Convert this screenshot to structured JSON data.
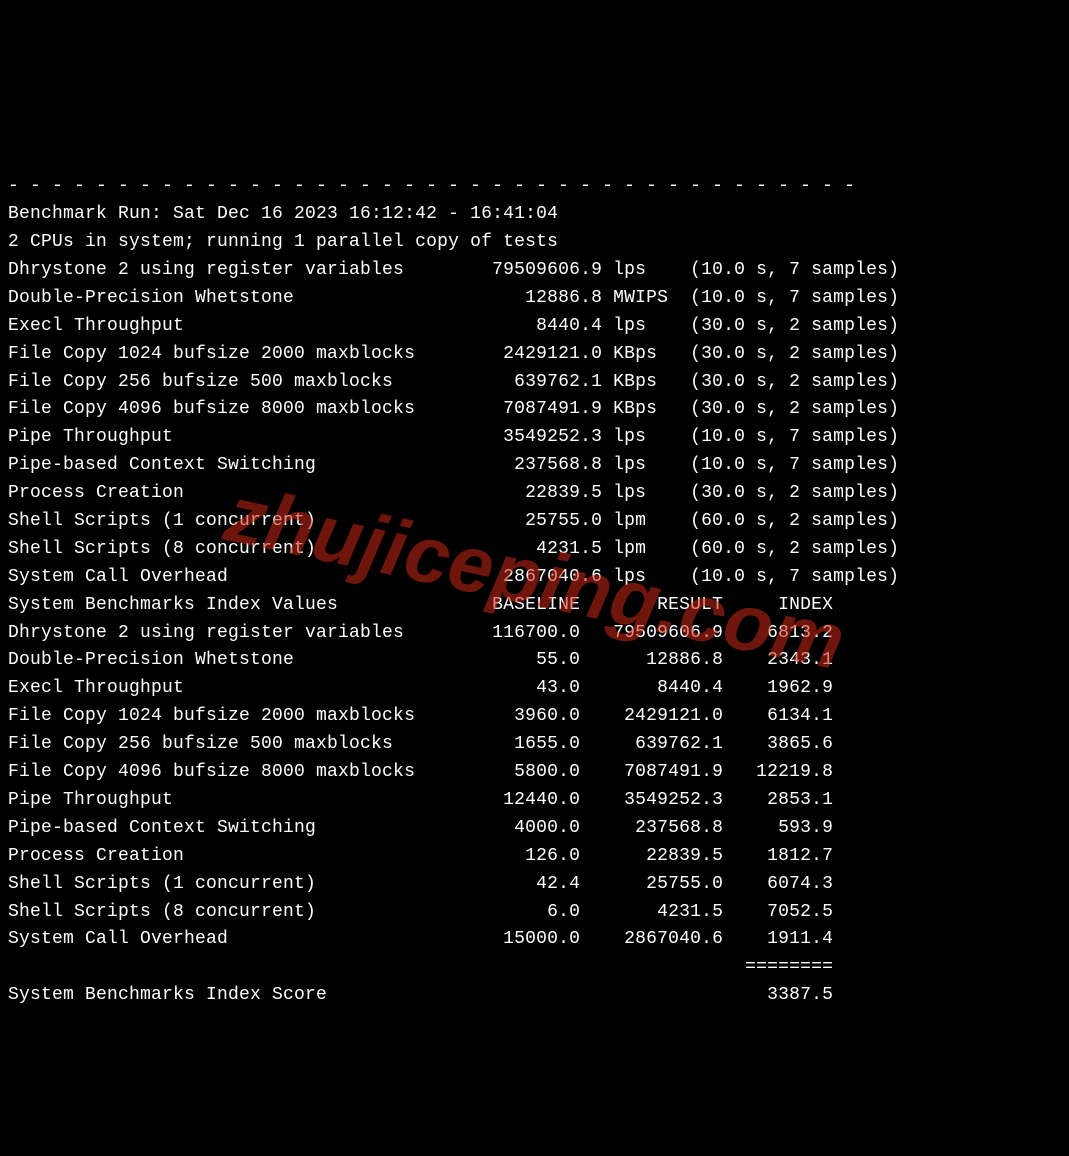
{
  "watermark": "zhujiceping.com",
  "separator_dash": "- - - - - - - - - - - - - - - - - - - - - - - - - - - - - - - - - - - - - - -",
  "run_line": "Benchmark Run: Sat Dec 16 2023 16:12:42 - 16:41:04",
  "cpu_line": "2 CPUs in system; running 1 parallel copy of tests",
  "tests": [
    {
      "name": "Dhrystone 2 using register variables",
      "value": "79509606.9",
      "unit": "lps",
      "duration": "10.0",
      "samples": "7"
    },
    {
      "name": "Double-Precision Whetstone",
      "value": "12886.8",
      "unit": "MWIPS",
      "duration": "10.0",
      "samples": "7"
    },
    {
      "name": "Execl Throughput",
      "value": "8440.4",
      "unit": "lps",
      "duration": "30.0",
      "samples": "2"
    },
    {
      "name": "File Copy 1024 bufsize 2000 maxblocks",
      "value": "2429121.0",
      "unit": "KBps",
      "duration": "30.0",
      "samples": "2"
    },
    {
      "name": "File Copy 256 bufsize 500 maxblocks",
      "value": "639762.1",
      "unit": "KBps",
      "duration": "30.0",
      "samples": "2"
    },
    {
      "name": "File Copy 4096 bufsize 8000 maxblocks",
      "value": "7087491.9",
      "unit": "KBps",
      "duration": "30.0",
      "samples": "2"
    },
    {
      "name": "Pipe Throughput",
      "value": "3549252.3",
      "unit": "lps",
      "duration": "10.0",
      "samples": "7"
    },
    {
      "name": "Pipe-based Context Switching",
      "value": "237568.8",
      "unit": "lps",
      "duration": "10.0",
      "samples": "7"
    },
    {
      "name": "Process Creation",
      "value": "22839.5",
      "unit": "lps",
      "duration": "30.0",
      "samples": "2"
    },
    {
      "name": "Shell Scripts (1 concurrent)",
      "value": "25755.0",
      "unit": "lpm",
      "duration": "60.0",
      "samples": "2"
    },
    {
      "name": "Shell Scripts (8 concurrent)",
      "value": "4231.5",
      "unit": "lpm",
      "duration": "60.0",
      "samples": "2"
    },
    {
      "name": "System Call Overhead",
      "value": "2867040.6",
      "unit": "lps",
      "duration": "10.0",
      "samples": "7"
    }
  ],
  "index_header": {
    "title": "System Benchmarks Index Values",
    "col_baseline": "BASELINE",
    "col_result": "RESULT",
    "col_index": "INDEX"
  },
  "index_rows": [
    {
      "name": "Dhrystone 2 using register variables",
      "baseline": "116700.0",
      "result": "79509606.9",
      "index": "6813.2"
    },
    {
      "name": "Double-Precision Whetstone",
      "baseline": "55.0",
      "result": "12886.8",
      "index": "2343.1"
    },
    {
      "name": "Execl Throughput",
      "baseline": "43.0",
      "result": "8440.4",
      "index": "1962.9"
    },
    {
      "name": "File Copy 1024 bufsize 2000 maxblocks",
      "baseline": "3960.0",
      "result": "2429121.0",
      "index": "6134.1"
    },
    {
      "name": "File Copy 256 bufsize 500 maxblocks",
      "baseline": "1655.0",
      "result": "639762.1",
      "index": "3865.6"
    },
    {
      "name": "File Copy 4096 bufsize 8000 maxblocks",
      "baseline": "5800.0",
      "result": "7087491.9",
      "index": "12219.8"
    },
    {
      "name": "Pipe Throughput",
      "baseline": "12440.0",
      "result": "3549252.3",
      "index": "2853.1"
    },
    {
      "name": "Pipe-based Context Switching",
      "baseline": "4000.0",
      "result": "237568.8",
      "index": "593.9"
    },
    {
      "name": "Process Creation",
      "baseline": "126.0",
      "result": "22839.5",
      "index": "1812.7"
    },
    {
      "name": "Shell Scripts (1 concurrent)",
      "baseline": "42.4",
      "result": "25755.0",
      "index": "6074.3"
    },
    {
      "name": "Shell Scripts (8 concurrent)",
      "baseline": "6.0",
      "result": "4231.5",
      "index": "7052.5"
    },
    {
      "name": "System Call Overhead",
      "baseline": "15000.0",
      "result": "2867040.6",
      "index": "1911.4"
    }
  ],
  "score_rule": "========",
  "score_label": "System Benchmarks Index Score",
  "score_value": "3387.5"
}
